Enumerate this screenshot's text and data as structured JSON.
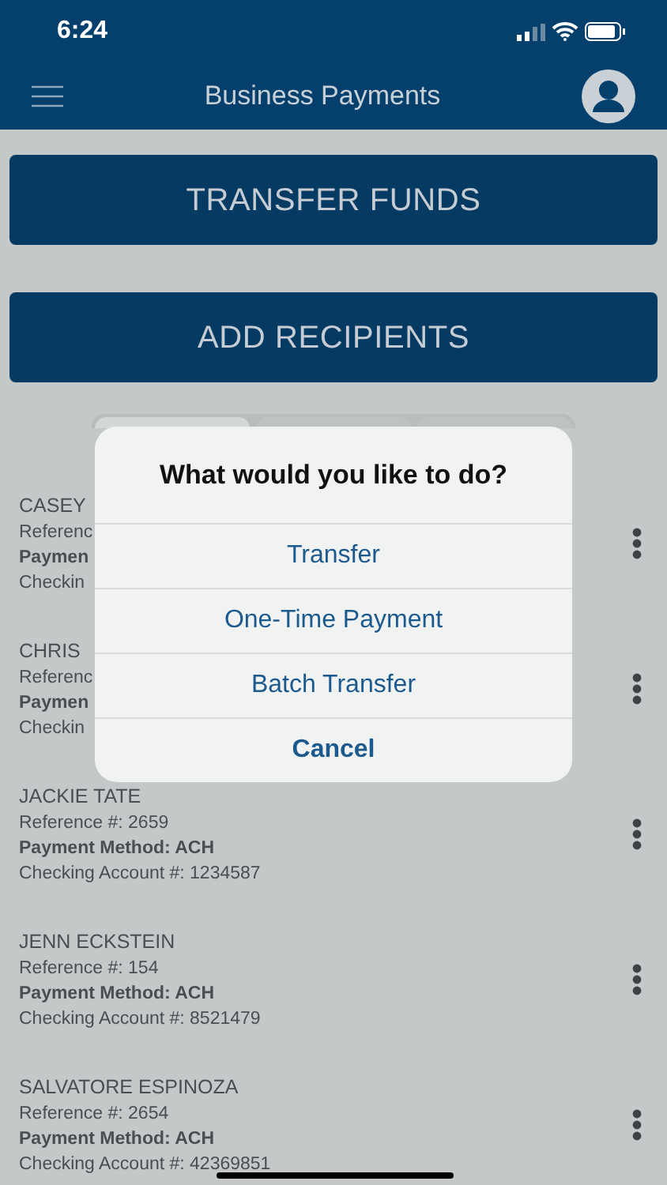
{
  "status_bar": {
    "time": "6:24"
  },
  "header": {
    "title": "Business Payments"
  },
  "actions": [
    "TRANSFER FUNDS",
    "ADD RECIPIENTS"
  ],
  "tabs": [
    {
      "selected": true
    },
    {
      "selected": false
    },
    {
      "selected": false
    }
  ],
  "recipients": [
    {
      "name": "CASEY",
      "reference": "Referenc",
      "method": "Paymen",
      "account": "Checkin"
    },
    {
      "name": "CHRIS",
      "reference": "Referenc",
      "method": "Paymen",
      "account": "Checkin"
    },
    {
      "name": "JACKIE TATE",
      "reference": "Reference #: 2659",
      "method": "Payment Method: ACH",
      "account": "Checking Account #: 1234587"
    },
    {
      "name": "JENN ECKSTEIN",
      "reference": "Reference #: 154",
      "method": "Payment Method: ACH",
      "account": "Checking Account #: 8521479"
    },
    {
      "name": "SALVATORE ESPINOZA",
      "reference": "Reference #: 2654",
      "method": "Payment Method: ACH",
      "account": "Checking Account #: 42369851"
    }
  ],
  "dialog": {
    "title": "What would you like to do?",
    "options": [
      {
        "label": "Transfer",
        "kind": "action"
      },
      {
        "label": "One-Time Payment",
        "kind": "action"
      },
      {
        "label": "Batch Transfer",
        "kind": "action"
      },
      {
        "label": "Cancel",
        "kind": "cancel"
      }
    ]
  }
}
